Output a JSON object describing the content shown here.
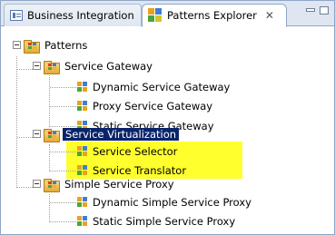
{
  "tabs": [
    {
      "label": "Business Integration",
      "icon": "business-integration-icon",
      "active": false
    },
    {
      "label": "Patterns Explorer",
      "icon": "patterns-explorer-icon",
      "active": true,
      "close": "✕"
    }
  ],
  "tree": {
    "root": {
      "label": "Patterns"
    },
    "groups": [
      {
        "label": "Service Gateway",
        "children": [
          "Dynamic Service Gateway",
          "Proxy Service Gateway",
          "Static Service Gateway"
        ]
      },
      {
        "label": "Service Virtualization",
        "selected": true,
        "children": [
          "Service Selector",
          "Service Translator"
        ],
        "highlighted": true
      },
      {
        "label": "Simple Service Proxy",
        "children": [
          "Dynamic Simple Service Proxy",
          "Static Simple Service Proxy"
        ]
      }
    ]
  },
  "colors": {
    "selection": "#0a246a",
    "highlight": "#ffff2e",
    "tab_bar": "#dfe6f1"
  }
}
